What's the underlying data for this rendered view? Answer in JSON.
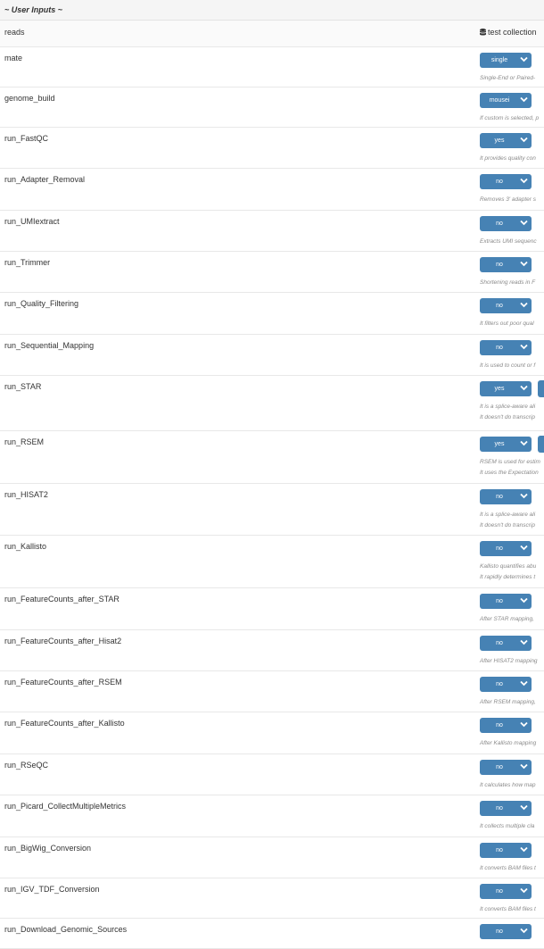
{
  "section": {
    "title": "~ User Inputs ~"
  },
  "reads": {
    "label": "reads",
    "collection": "test collection",
    "icon": "database-icon"
  },
  "params": [
    {
      "label": "mate",
      "value": "single",
      "desc": [
        "Single-End or Paired-"
      ]
    },
    {
      "label": "genome_build",
      "value": "mousei",
      "desc": [
        "If custom is selected, p"
      ]
    },
    {
      "label": "run_FastQC",
      "value": "yes",
      "desc": [
        "It provides quality con"
      ]
    },
    {
      "label": "run_Adapter_Removal",
      "value": "no",
      "desc": [
        "Removes 3' adapter s"
      ]
    },
    {
      "label": "run_UMIextract",
      "value": "no",
      "desc": [
        "Extracts UMI sequenc"
      ]
    },
    {
      "label": "run_Trimmer",
      "value": "no",
      "desc": [
        "Shortening reads in F"
      ]
    },
    {
      "label": "run_Quality_Filtering",
      "value": "no",
      "desc": [
        "It filters out poor qual"
      ]
    },
    {
      "label": "run_Sequential_Mapping",
      "value": "no",
      "desc": [
        "It is used to count or f"
      ]
    },
    {
      "label": "run_STAR",
      "value": "yes",
      "extra": true,
      "desc": [
        "It is a splice-aware ali",
        "It doesn't do transcrip"
      ]
    },
    {
      "label": "run_RSEM",
      "value": "yes",
      "extra": true,
      "desc": [
        "RSEM is used for estim",
        "It uses the Expectation"
      ]
    },
    {
      "label": "run_HISAT2",
      "value": "no",
      "desc": [
        "It is a splice-aware ali",
        "It doesn't do transcrip"
      ]
    },
    {
      "label": "run_Kallisto",
      "value": "no",
      "desc": [
        "Kallisto quantifies abu",
        "It rapidly determines t"
      ]
    },
    {
      "label": "run_FeatureCounts_after_STAR",
      "value": "no",
      "desc": [
        "After STAR mapping, "
      ]
    },
    {
      "label": "run_FeatureCounts_after_Hisat2",
      "value": "no",
      "desc": [
        "After HISAT2 mapping"
      ]
    },
    {
      "label": "run_FeatureCounts_after_RSEM",
      "value": "no",
      "desc": [
        "After RSEM mapping, "
      ]
    },
    {
      "label": "run_FeatureCounts_after_Kallisto",
      "value": "no",
      "desc": [
        "After Kallisto mapping"
      ]
    },
    {
      "label": "run_RSeQC",
      "value": "no",
      "desc": [
        "It calculates how map"
      ]
    },
    {
      "label": "run_Picard_CollectMultipleMetrics",
      "value": "no",
      "desc": [
        "It collects multiple cla"
      ]
    },
    {
      "label": "run_BigWig_Conversion",
      "value": "no",
      "desc": [
        "It converts BAM files t"
      ]
    },
    {
      "label": "run_IGV_TDF_Conversion",
      "value": "no",
      "desc": [
        "It converts BAM files t"
      ]
    },
    {
      "label": "run_Download_Genomic_Sources",
      "value": "no",
      "desc": []
    }
  ],
  "icons": {
    "dropdown": "chevron-down-icon"
  },
  "colors": {
    "select_bg": "#4682b4",
    "header_bg": "#f5f5f5"
  }
}
